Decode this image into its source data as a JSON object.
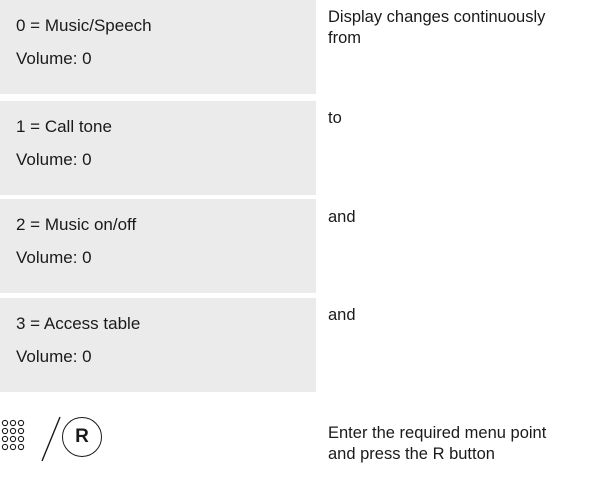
{
  "steps": [
    {
      "display_line1": "0 = Music/Speech",
      "display_line2": "Volume: 0",
      "description": "Display changes continuously\nfrom"
    },
    {
      "display_line1": "1 = Call tone",
      "display_line2": "Volume: 0",
      "description": "to"
    },
    {
      "display_line1": "2 = Music on/off",
      "display_line2": "Volume: 0",
      "description": "and"
    },
    {
      "display_line1": "3 = Access table",
      "display_line2": "Volume: 0",
      "description": "and"
    }
  ],
  "action": {
    "keypad_icon": "keypad-icon",
    "separator": "/",
    "r_button_label": "R",
    "description": "Enter the required menu point\nand press the R button"
  }
}
